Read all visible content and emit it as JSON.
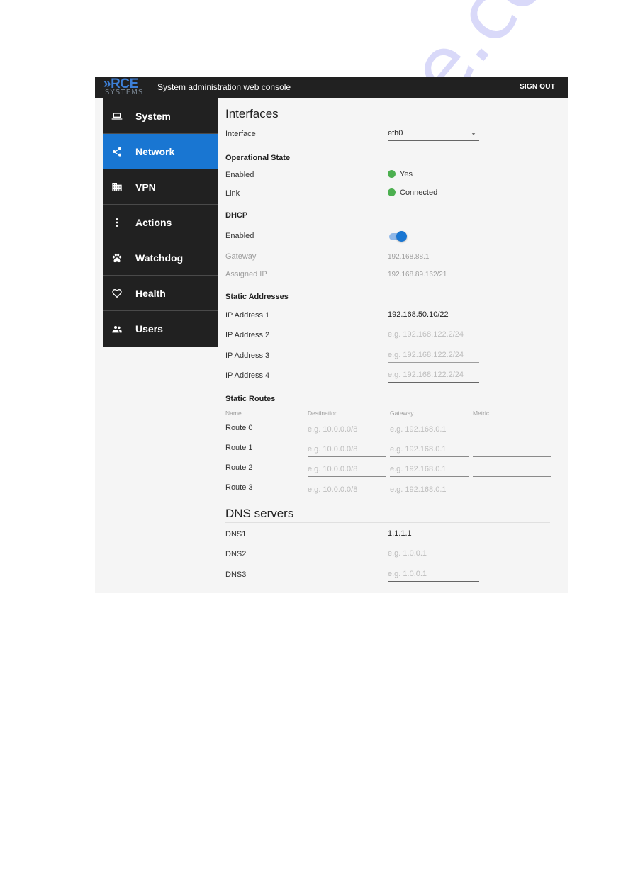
{
  "header": {
    "logo_primary": "RCE",
    "logo_secondary": "SYSTEMS",
    "logo_chevron": "»",
    "title": "System administration web console",
    "sign_out_label": "SIGN OUT"
  },
  "sidebar": {
    "items": [
      {
        "label": "System",
        "icon": "laptop-icon",
        "active": false
      },
      {
        "label": "Network",
        "icon": "share-icon",
        "active": true
      },
      {
        "label": "VPN",
        "icon": "building-icon",
        "active": false
      },
      {
        "label": "Actions",
        "icon": "more-vertical-icon",
        "active": false
      },
      {
        "label": "Watchdog",
        "icon": "paw-icon",
        "active": false
      },
      {
        "label": "Health",
        "icon": "heart-icon",
        "active": false
      },
      {
        "label": "Users",
        "icon": "people-icon",
        "active": false
      }
    ]
  },
  "interfaces": {
    "title": "Interfaces",
    "interface_label": "Interface",
    "interface_value": "eth0",
    "operational_state": {
      "heading": "Operational State",
      "enabled_label": "Enabled",
      "enabled_value": "Yes",
      "link_label": "Link",
      "link_value": "Connected",
      "status_color": "#4caf50"
    },
    "dhcp": {
      "heading": "DHCP",
      "enabled_label": "Enabled",
      "enabled": true,
      "gateway_label": "Gateway",
      "gateway_value": "192.168.88.1",
      "assigned_ip_label": "Assigned IP",
      "assigned_ip_value": "192.168.89.162/21"
    },
    "static_addresses": {
      "heading": "Static Addresses",
      "items": [
        {
          "label": "IP Address 1",
          "value": "192.168.50.10/22",
          "placeholder": "e.g. 192.168.122.2/24"
        },
        {
          "label": "IP Address 2",
          "value": "",
          "placeholder": "e.g. 192.168.122.2/24"
        },
        {
          "label": "IP Address 3",
          "value": "",
          "placeholder": "e.g. 192.168.122.2/24"
        },
        {
          "label": "IP Address 4",
          "value": "",
          "placeholder": "e.g. 192.168.122.2/24"
        }
      ]
    },
    "static_routes": {
      "heading": "Static Routes",
      "columns": [
        "Name",
        "Destination",
        "Gateway",
        "Metric"
      ],
      "routes": [
        {
          "name": "Route 0",
          "destination": "",
          "destination_placeholder": "e.g. 10.0.0.0/8",
          "gateway": "",
          "gateway_placeholder": "e.g. 192.168.0.1",
          "metric": ""
        },
        {
          "name": "Route 1",
          "destination": "",
          "destination_placeholder": "e.g. 10.0.0.0/8",
          "gateway": "",
          "gateway_placeholder": "e.g. 192.168.0.1",
          "metric": ""
        },
        {
          "name": "Route 2",
          "destination": "",
          "destination_placeholder": "e.g. 10.0.0.0/8",
          "gateway": "",
          "gateway_placeholder": "e.g. 192.168.0.1",
          "metric": ""
        },
        {
          "name": "Route 3",
          "destination": "",
          "destination_placeholder": "e.g. 10.0.0.0/8",
          "gateway": "",
          "gateway_placeholder": "e.g. 192.168.0.1",
          "metric": ""
        }
      ]
    }
  },
  "dns": {
    "title": "DNS servers",
    "items": [
      {
        "label": "DNS1",
        "value": "1.1.1.1",
        "placeholder": "e.g. 1.0.0.1"
      },
      {
        "label": "DNS2",
        "value": "",
        "placeholder": "e.g. 1.0.0.1"
      },
      {
        "label": "DNS3",
        "value": "",
        "placeholder": "e.g. 1.0.0.1"
      }
    ]
  },
  "colors": {
    "accent": "#1976d2",
    "topbar": "#212121",
    "sidebar": "#212121",
    "content_bg": "#f5f5f5"
  },
  "watermark": "manualshive.com"
}
